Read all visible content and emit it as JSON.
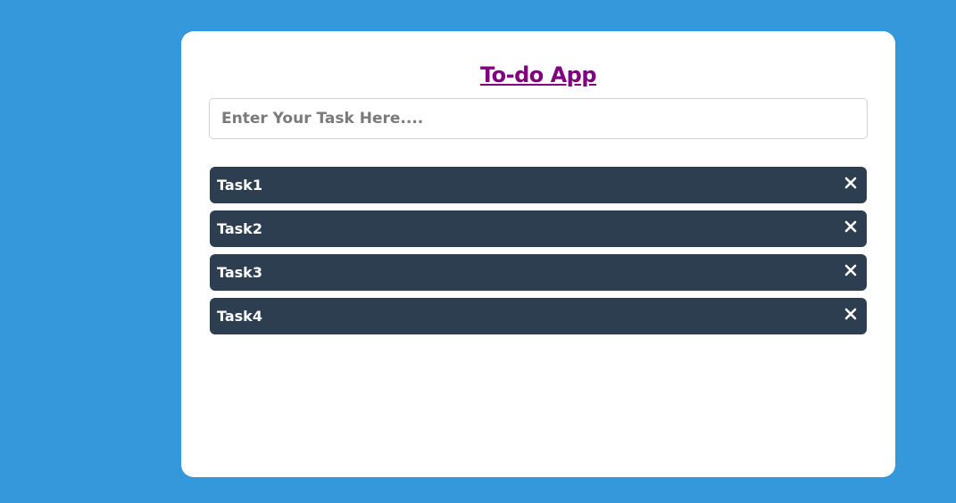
{
  "app": {
    "title": "To-do App"
  },
  "input": {
    "placeholder": "Enter Your Task Here....",
    "value": ""
  },
  "tasks": [
    {
      "label": "Task1",
      "delete_icon": "close-icon"
    },
    {
      "label": "Task2",
      "delete_icon": "close-icon"
    },
    {
      "label": "Task3",
      "delete_icon": "close-icon"
    },
    {
      "label": "Task4",
      "delete_icon": "close-icon"
    }
  ],
  "colors": {
    "background": "#3498db",
    "card": "#ffffff",
    "title": "#800080",
    "task_item": "#2c3e50",
    "task_text": "#ffffff"
  }
}
